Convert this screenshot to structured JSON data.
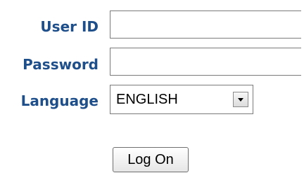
{
  "form": {
    "userid_label": "User ID",
    "userid_value": "",
    "password_label": "Password",
    "password_value": "",
    "language_label": "Language",
    "language_selected": "ENGLISH",
    "logon_button": "Log On"
  },
  "colors": {
    "label": "#1f4f8a",
    "background": "#ffffff"
  },
  "icons": {
    "language_dropdown": "chevron-down-icon"
  }
}
